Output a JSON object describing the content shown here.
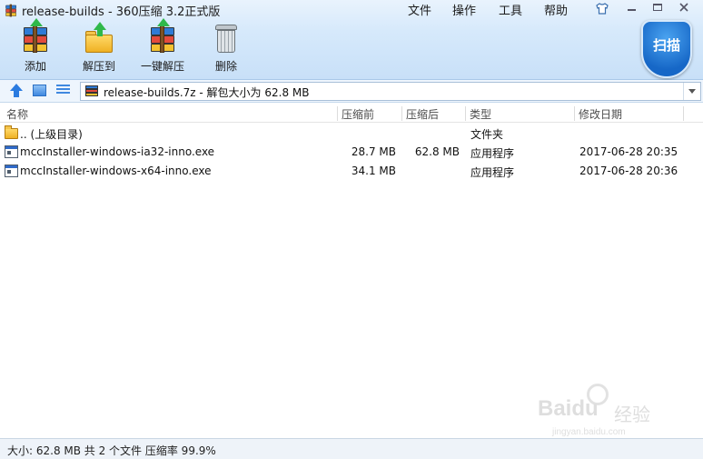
{
  "window": {
    "title": "release-builds - 360压缩 3.2正式版"
  },
  "menu": {
    "file": "文件",
    "operation": "操作",
    "tools": "工具",
    "help": "帮助"
  },
  "toolbar": {
    "add": "添加",
    "extract_to": "解压到",
    "one_click_extract": "一键解压",
    "delete": "删除",
    "scan": "扫描"
  },
  "address": {
    "path": "release-builds.7z - 解包大小为 62.8 MB"
  },
  "columns": {
    "name": "名称",
    "packed": "压缩前",
    "size": "压缩后",
    "type": "类型",
    "modified": "修改日期"
  },
  "files": [
    {
      "name": ".. (上级目录)",
      "packed": "",
      "size": "",
      "type": "文件夹",
      "modified": "",
      "icon": "folder-icon"
    },
    {
      "name": "mccInstaller-windows-ia32-inno.exe",
      "packed": "28.7 MB",
      "size": "62.8 MB",
      "type": "应用程序",
      "modified": "2017-06-28 20:35",
      "icon": "exe-icon"
    },
    {
      "name": "mccInstaller-windows-x64-inno.exe",
      "packed": "34.1 MB",
      "size": "",
      "type": "应用程序",
      "modified": "2017-06-28 20:36",
      "icon": "exe-icon"
    }
  ],
  "status": {
    "text": "大小: 62.8 MB 共 2 个文件 压缩率 99.9%"
  },
  "watermark": {
    "brand": "Baidu",
    "brand_cn": "经验",
    "url": "jingyan.baidu.com"
  },
  "colors": {
    "toolbar_bg": "#d6e9fb",
    "scan_shield": "#1667c7",
    "accent": "#2b7be0"
  }
}
